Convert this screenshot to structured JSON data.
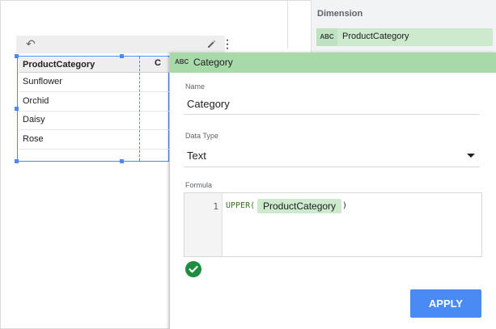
{
  "dimension_panel": {
    "title": "Dimension",
    "chip_type": "ABC",
    "chip_label": "ProductCategory"
  },
  "table": {
    "columns": [
      "ProductCategory",
      "C"
    ],
    "rows": [
      "Sunflower",
      "Orchid",
      "Daisy",
      "Rose"
    ]
  },
  "dialog": {
    "type_badge": "ABC",
    "title": "Category",
    "name_label": "Name",
    "name_value": "Category",
    "datatype_label": "Data Type",
    "datatype_value": "Text",
    "formula_label": "Formula",
    "line_number": "1",
    "formula_function": "UPPER(",
    "formula_field": "ProductCategory",
    "formula_close": ")",
    "apply_label": "APPLY"
  },
  "icons": {
    "undo": "undo-icon",
    "edit": "pencil-icon",
    "more": "more-vert-icon",
    "dropdown": "chevron-down-icon",
    "valid": "check-circle-icon"
  },
  "colors": {
    "accent": "#4a8af4",
    "dimension_green": "#a8d9a9",
    "chip_green": "#cdeacf",
    "valid_green": "#1e8e3e"
  }
}
